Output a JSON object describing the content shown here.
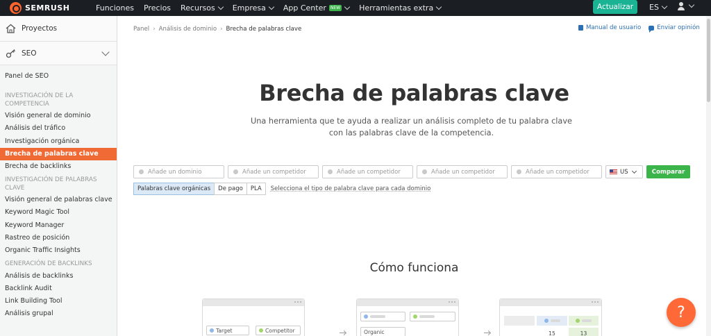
{
  "topnav": {
    "logo": "SEMRUSH",
    "items": [
      {
        "label": "Funciones",
        "dropdown": false
      },
      {
        "label": "Precios",
        "dropdown": false
      },
      {
        "label": "Recursos",
        "dropdown": true
      },
      {
        "label": "Empresa",
        "dropdown": true
      },
      {
        "label": "App Center",
        "dropdown": true,
        "badge": "NEW"
      },
      {
        "label": "Herramientas extra",
        "dropdown": true
      }
    ],
    "upgrade_label": "Actualizar",
    "language": "ES",
    "accent_color": "#1ab394"
  },
  "sidebar": {
    "projects_label": "Proyectos",
    "seo_label": "SEO",
    "dashboard": "Panel de SEO",
    "sections": [
      {
        "title": "INVESTIGACIÓN DE LA COMPETENCIA",
        "items": [
          "Visión general de dominio",
          "Análisis del tráfico",
          "Investigación orgánica",
          "Brecha de palabras clave",
          "Brecha de backlinks"
        ]
      },
      {
        "title": "INVESTIGACIÓN DE PALABRAS CLAVE",
        "items": [
          "Visión general de palabras clave",
          "Keyword Magic Tool",
          "Keyword Manager",
          "Rastreo de posición",
          "Organic Traffic Insights"
        ]
      },
      {
        "title": "GENERACIÓN DE BACKLINKS",
        "items": [
          "Análisis de backlinks",
          "Backlink Audit",
          "Link Building Tool",
          "Análisis grupal"
        ]
      }
    ],
    "active_item": "Brecha de palabras clave",
    "active_color": "#f06a35"
  },
  "breadcrumb": [
    "Panel",
    "Análisis de dominio",
    "Brecha de palabras clave"
  ],
  "help_links": {
    "manual": "Manual de usuario",
    "feedback": "Enviar opinión"
  },
  "main": {
    "title": "Brecha de palabras clave",
    "subtitle": "Una herramienta que te ayuda a realizar un análisis completo de tu palabra clave con las palabras clave de la competencia.",
    "form": {
      "domain_placeholder": "Añade un dominio",
      "competitor_placeholder": "Añade un competidor",
      "competitor_count": 4,
      "country": "US",
      "compare_label": "Comparar",
      "compare_color": "#3bb54a"
    },
    "keyword_types": [
      "Palabras clave orgánicas",
      "De pago",
      "PLA"
    ],
    "keyword_type_selected": "Palabras clave orgánicas",
    "keyword_hint": "Selecciona el tipo de palabra clave para cada dominio",
    "how_title": "Cómo funciona",
    "illustration": {
      "card1": {
        "target": "Target",
        "competitor": "Competitor"
      },
      "card2": {
        "type": "Organic"
      },
      "card3": {
        "values": [
          "15",
          "13"
        ]
      }
    }
  },
  "help_fab": "?"
}
